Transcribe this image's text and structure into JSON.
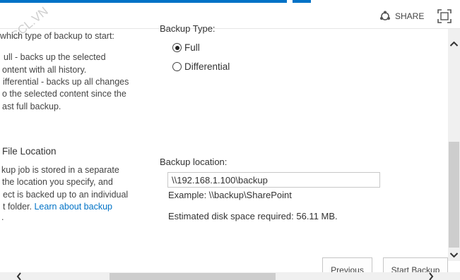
{
  "header": {
    "share_label": "SHARE",
    "icons": {
      "share": "share-icon",
      "focus": "focus-on-content-icon"
    },
    "accent_color": "#0072c6"
  },
  "watermark": {
    "text": "CCL.VN"
  },
  "backup_type_section": {
    "description_lines": [
      "which type of backup to start:",
      "ull - backs up the selected",
      "ontent with all history.",
      "ifferential - backs up all changes",
      "o the selected content since the",
      "ast full backup."
    ],
    "label": "Backup Type:",
    "options": [
      {
        "label": "Full",
        "checked": true
      },
      {
        "label": "Differential",
        "checked": false
      }
    ]
  },
  "file_location_section": {
    "title": "File Location",
    "description_lines": [
      "kup job is stored in a separate",
      "the location you specify, and",
      "ect is backed up to an individual",
      "t folder. "
    ],
    "link_text": "Learn about backup",
    "trailing_text": ".",
    "label": "Backup location:",
    "input_value": "\\\\192.168.1.100\\backup",
    "example": "Example: \\\\backup\\SharePoint",
    "estimate": "Estimated disk space required: 56.11 MB."
  },
  "buttons": {
    "previous": "Previous",
    "start": "Start Backup"
  }
}
